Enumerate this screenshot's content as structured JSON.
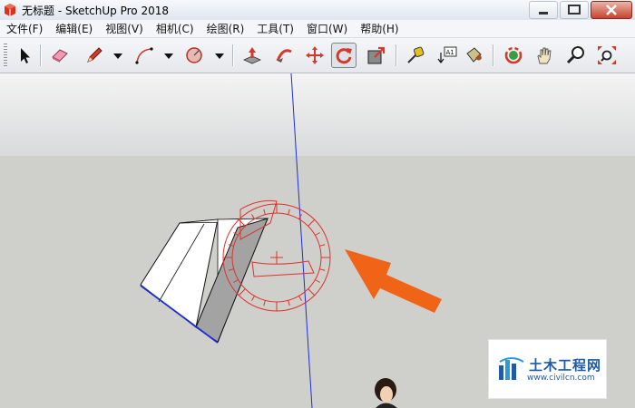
{
  "window": {
    "title": "无标题 - SketchUp Pro 2018"
  },
  "menu": {
    "items": [
      "文件(F)",
      "编辑(E)",
      "视图(V)",
      "相机(C)",
      "绘图(R)",
      "工具(T)",
      "窗口(W)",
      "帮助(H)"
    ]
  },
  "toolbar": {
    "tools": [
      "select-icon",
      "eraser-icon",
      "pencil-icon",
      "arc-icon",
      "shape-icon",
      "push-pull-icon",
      "follow-me-icon",
      "move-icon",
      "rotate-icon",
      "scale-icon",
      "tape-measure-icon",
      "text-icon",
      "paint-bucket-icon",
      "orbit-icon",
      "pan-icon",
      "zoom-icon",
      "zoom-extents-icon"
    ],
    "active_tool": "rotate-icon",
    "text_tool_label": "A1"
  },
  "viewport": {
    "colors": {
      "sky": "#e9eaea",
      "ground": "#cfcfcb",
      "protractor": "#e0322a",
      "axis_blue": "#1f2ed6",
      "annotation_arrow": "#f06418"
    }
  },
  "watermark": {
    "name": "土木工程网",
    "url": "www.civilcn.com"
  }
}
